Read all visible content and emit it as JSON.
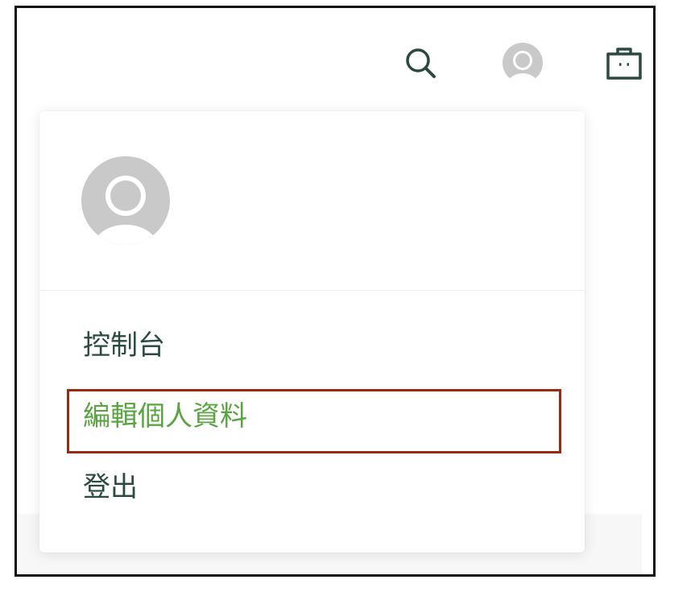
{
  "header": {
    "icons": [
      "search-icon",
      "avatar-icon",
      "shopping-bag-icon"
    ]
  },
  "account_menu": {
    "items": [
      {
        "label": "控制台",
        "active": false
      },
      {
        "label": "編輯個人資料",
        "active": true
      },
      {
        "label": "登出",
        "active": false
      }
    ]
  },
  "colors": {
    "icon": "#2a4a40",
    "menu_text": "#294b40",
    "active_text": "#58a43e",
    "highlight_border": "#9b2a12",
    "avatar_placeholder": "#c9c9c9"
  }
}
